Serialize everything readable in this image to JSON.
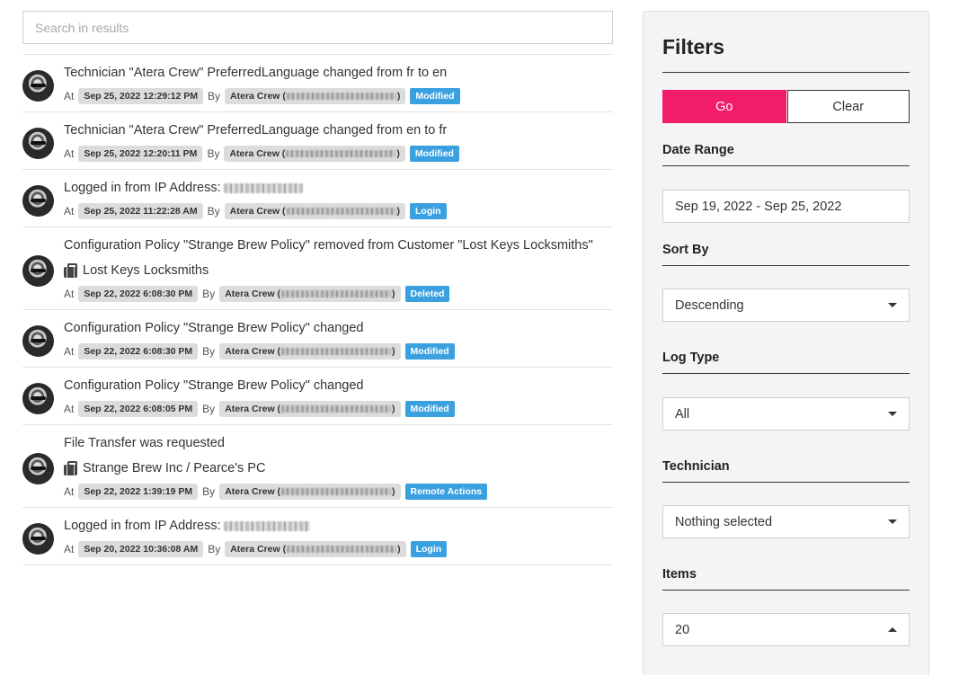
{
  "search": {
    "placeholder": "Search in results"
  },
  "labels": {
    "at": "At",
    "by": "By"
  },
  "logs": [
    {
      "title": "Technician \"Atera Crew\" PreferredLanguage changed from fr to en",
      "date": "Sep 25, 2022 12:29:12 PM",
      "by": "Atera Crew (",
      "by_end": ")",
      "badge": "Modified"
    },
    {
      "title": "Technician \"Atera Crew\" PreferredLanguage changed from en to fr",
      "date": "Sep 25, 2022 12:20:11 PM",
      "by": "Atera Crew (",
      "by_end": ")",
      "badge": "Modified"
    },
    {
      "title": "Logged in from IP Address:",
      "date": "Sep 25, 2022 11:22:28 AM",
      "by": "Atera Crew (",
      "by_end": ")",
      "badge": "Login"
    },
    {
      "title": "Configuration Policy \"Strange Brew Policy\" removed from Customer \"Lost Keys Locksmiths\"",
      "customer": "Lost Keys Locksmiths",
      "date": "Sep 22, 2022 6:08:30 PM",
      "by": "Atera Crew (",
      "by_end": ")",
      "badge": "Deleted"
    },
    {
      "title": "Configuration Policy \"Strange Brew Policy\" changed",
      "date": "Sep 22, 2022 6:08:30 PM",
      "by": "Atera Crew (",
      "by_end": ")",
      "badge": "Modified"
    },
    {
      "title": "Configuration Policy \"Strange Brew Policy\" changed",
      "date": "Sep 22, 2022 6:08:05 PM",
      "by": "Atera Crew (",
      "by_end": ")",
      "badge": "Modified"
    },
    {
      "title": "File Transfer was requested",
      "customer": "Strange Brew Inc / Pearce's PC",
      "date": "Sep 22, 2022 1:39:19 PM",
      "by": "Atera Crew (",
      "by_end": ")",
      "badge": "Remote Actions"
    },
    {
      "title": "Logged in from IP Address:",
      "date": "Sep 20, 2022 10:36:08 AM",
      "by": "Atera Crew (",
      "by_end": ")",
      "badge": "Login"
    }
  ],
  "filters": {
    "title": "Filters",
    "go_label": "Go",
    "clear_label": "Clear",
    "date_range_label": "Date Range",
    "date_range_value": "Sep 19, 2022 - Sep 25, 2022",
    "sort_by_label": "Sort By",
    "sort_by_value": "Descending",
    "log_type_label": "Log Type",
    "log_type_value": "All",
    "technician_label": "Technician",
    "technician_value": "Nothing selected",
    "items_label": "Items",
    "items_value": "20"
  },
  "colors": {
    "go": "#f21c6a",
    "badge": "#3aa0e0"
  }
}
